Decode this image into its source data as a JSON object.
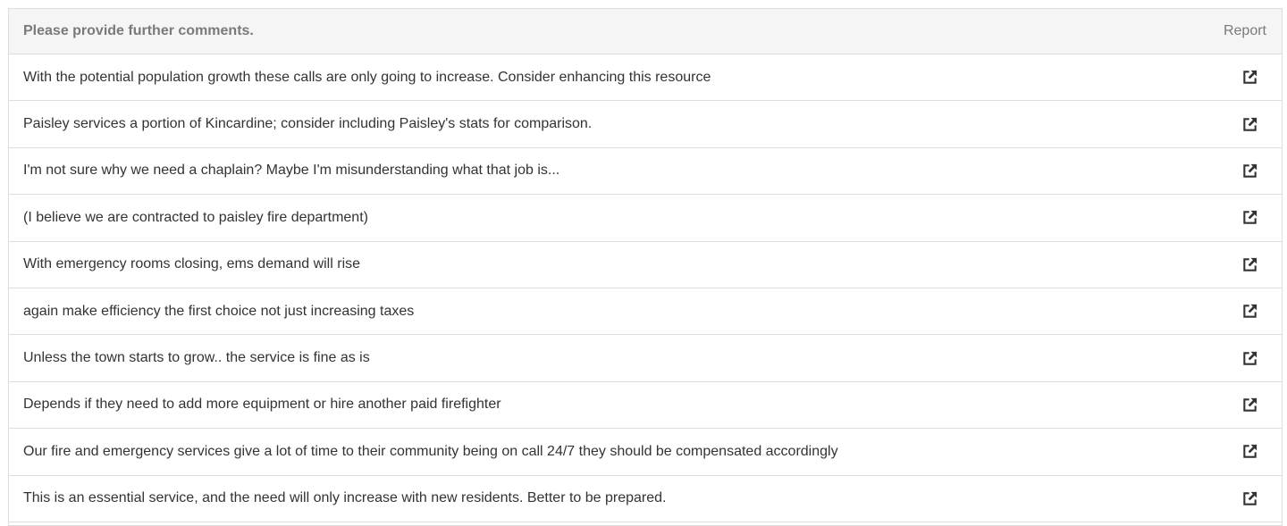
{
  "header": {
    "title": "Please provide further comments.",
    "report_label": "Report"
  },
  "colors": {
    "header_bg": "#f5f5f5",
    "border": "#dddddd",
    "header_text": "#7a7a7a",
    "row_text": "#333333",
    "icon": "#333333"
  },
  "rows": [
    {
      "comment": "With the potential population growth these calls are only going to increase. Consider enhancing this resource",
      "icon": "external-link-icon"
    },
    {
      "comment": "Paisley services a portion of Kincardine; consider including Paisley's stats for comparison.",
      "icon": "external-link-icon"
    },
    {
      "comment": "I'm not sure why we need a chaplain? Maybe I'm misunderstanding what that job is...",
      "icon": "external-link-icon"
    },
    {
      "comment": "(I believe we are contracted to paisley fire department)",
      "icon": "external-link-icon"
    },
    {
      "comment": "With emergency rooms closing, ems demand will rise",
      "icon": "external-link-icon"
    },
    {
      "comment": "again make efficiency the first choice not just increasing taxes",
      "icon": "external-link-icon"
    },
    {
      "comment": "Unless the town starts to grow.. the service is fine as is",
      "icon": "external-link-icon"
    },
    {
      "comment": "Depends if they need to add more equipment or hire another paid firefighter",
      "icon": "external-link-icon"
    },
    {
      "comment": "Our fire and emergency services give a lot of time to their community being on call 24/7 they should be compensated accordingly",
      "icon": "external-link-icon"
    },
    {
      "comment": "This is an essential service, and the need will only increase with new residents. Better to be prepared.",
      "icon": "external-link-icon"
    }
  ]
}
